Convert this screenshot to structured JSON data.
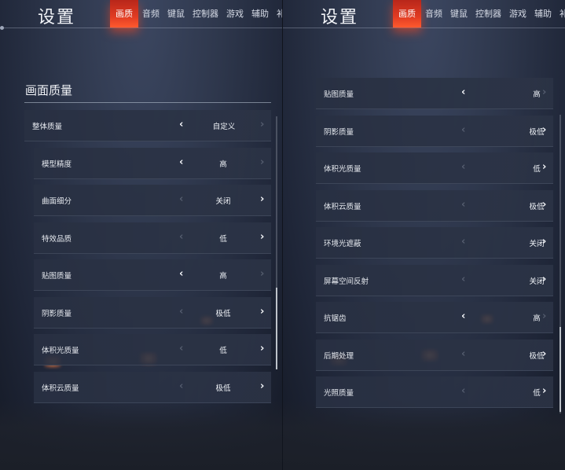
{
  "title": "设置",
  "tabs": [
    "画质",
    "音频",
    "键鼠",
    "控制器",
    "游戏",
    "辅助",
    "补"
  ],
  "section_title": "画面质量",
  "left_rows": [
    {
      "label": "整体质量",
      "value": "自定义",
      "left": "on",
      "right": "off"
    },
    {
      "label": "模型精度",
      "value": "高",
      "left": "on",
      "right": "off"
    },
    {
      "label": "曲面细分",
      "value": "关闭",
      "left": "off",
      "right": "on"
    },
    {
      "label": "特效品质",
      "value": "低",
      "left": "off",
      "right": "on"
    },
    {
      "label": "贴图质量",
      "value": "高",
      "left": "on",
      "right": "off"
    },
    {
      "label": "阴影质量",
      "value": "极低",
      "left": "off",
      "right": "on"
    },
    {
      "label": "体积光质量",
      "value": "低",
      "left": "off",
      "right": "on"
    },
    {
      "label": "体积云质量",
      "value": "极低",
      "left": "off",
      "right": "on"
    }
  ],
  "right_rows": [
    {
      "label": "贴图质量",
      "value": "高",
      "left": "on",
      "right": "off"
    },
    {
      "label": "阴影质量",
      "value": "极低",
      "left": "off",
      "right": "on"
    },
    {
      "label": "体积光质量",
      "value": "低",
      "left": "off",
      "right": "on"
    },
    {
      "label": "体积云质量",
      "value": "极低",
      "left": "off",
      "right": "on"
    },
    {
      "label": "环境光遮蔽",
      "value": "关闭",
      "left": "off",
      "right": "on"
    },
    {
      "label": "屏幕空间反射",
      "value": "关闭",
      "left": "off",
      "right": "on"
    },
    {
      "label": "抗锯齿",
      "value": "高",
      "left": "on",
      "right": "off"
    },
    {
      "label": "后期处理",
      "value": "极低",
      "left": "off",
      "right": "on"
    },
    {
      "label": "光照质量",
      "value": "低",
      "left": "off",
      "right": "on"
    }
  ],
  "colors": {
    "accent": "#e03b22",
    "panel_bg": "#2e374c",
    "row_bg": "#2c3446"
  }
}
